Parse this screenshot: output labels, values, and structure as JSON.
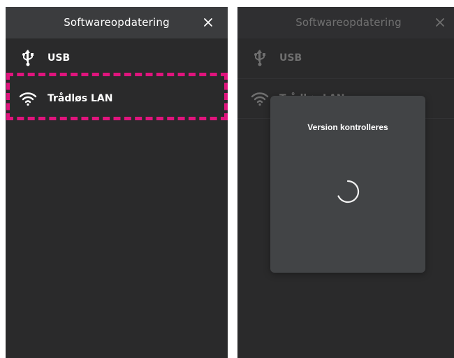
{
  "left_screen": {
    "header": {
      "title": "Softwareopdatering",
      "close_icon": "close-icon"
    },
    "items": [
      {
        "label": "USB",
        "icon": "usb-icon"
      },
      {
        "label": "Trådløs LAN",
        "icon": "wifi-icon"
      }
    ],
    "highlight_color": "#e0147d"
  },
  "right_screen": {
    "header": {
      "title": "Softwareopdatering",
      "close_icon": "close-icon"
    },
    "items": [
      {
        "label": "USB",
        "icon": "usb-icon"
      },
      {
        "label": "Trådløs LAN",
        "icon": "wifi-icon"
      }
    ],
    "dialog": {
      "title": "Version kontrolleres",
      "indicator": "loading-spinner"
    }
  },
  "colors": {
    "background": "#2a2a2b",
    "header": "#3b3c3e",
    "dialog": "#424446",
    "text": "#ffffff"
  }
}
